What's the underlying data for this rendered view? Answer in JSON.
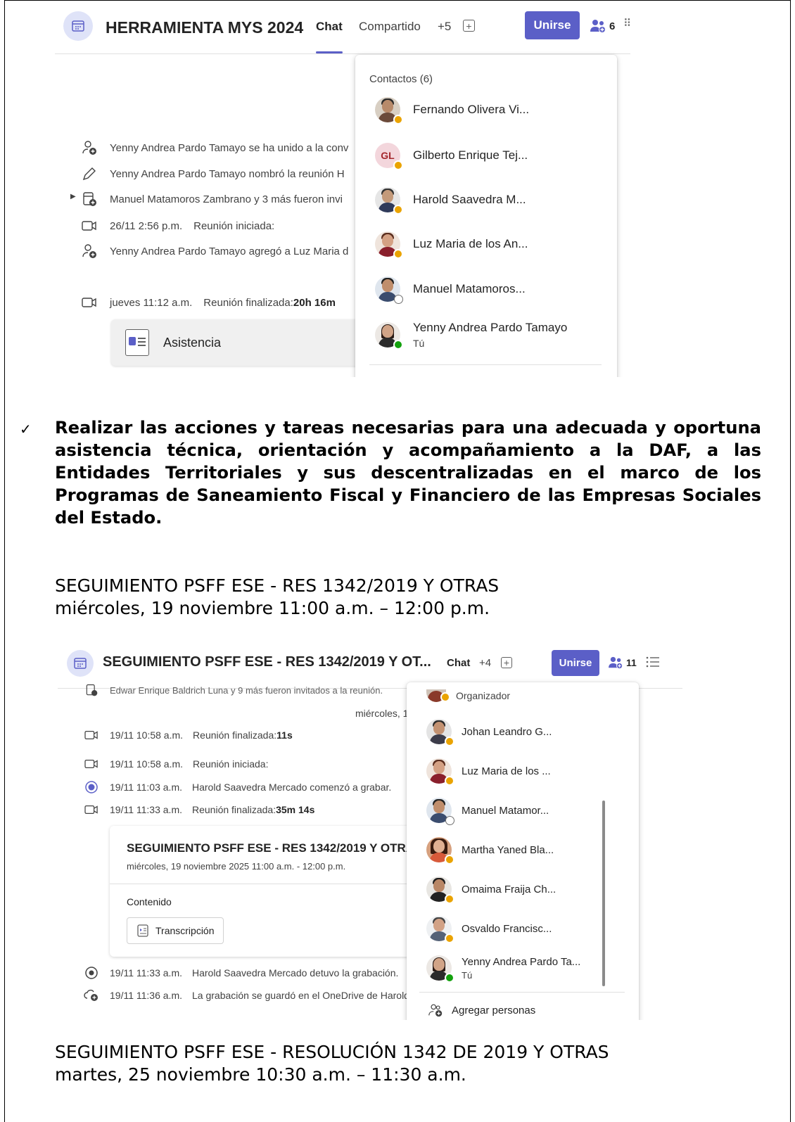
{
  "shot1": {
    "title": "HERRAMIENTA MYS 2024",
    "tabs": {
      "chat": "Chat",
      "shared": "Compartido",
      "more": "+5"
    },
    "join_label": "Unirse",
    "people_count": "6",
    "events": [
      "Yenny Andrea Pardo Tamayo se ha unido a la conv",
      "Yenny Andrea Pardo Tamayo nombró la reunión H",
      "Manuel Matamoros Zambrano y 3 más fueron invi",
      {
        "time": "26/11 2:56 p.m.",
        "text": "Reunión iniciada:"
      },
      "Yenny Andrea Pardo Tamayo agregó a Luz Maria d",
      {
        "time": "jueves 11:12 a.m.",
        "text": "Reunión finalizada: ",
        "duration": "20h 16m"
      }
    ],
    "attendance_label": "Asistencia",
    "contacts_heading": "Contactos (6)",
    "contacts": [
      {
        "name": "Fernando Olivera Vi...",
        "status": "away"
      },
      {
        "name": "Gilberto Enrique Tej...",
        "initials": "GL",
        "status": "away"
      },
      {
        "name": "Harold Saavedra M...",
        "status": "away"
      },
      {
        "name": "Luz Maria de los An...",
        "status": "away"
      },
      {
        "name": "Manuel Matamoros...",
        "status": "offline"
      },
      {
        "name": "Yenny Andrea Pardo Tamayo",
        "sub": "Tú",
        "status": "available"
      }
    ]
  },
  "body": {
    "check_mark": "✓",
    "bold_paragraph": "Realizar las acciones y tareas necesarias para una adecuada y oportuna asistencia técnica, orientación y acompañamiento a la DAF, a las Entidades Territoriales y sus descentralizadas en el marco de los Programas de Saneamiento Fiscal y Financiero de las Empresas Sociales del Estado.",
    "meeting1_title": "SEGUIMIENTO PSFF ESE - RES 1342/2019 Y OTRAS",
    "meeting1_time": "miércoles, 19 noviembre 11:00 a.m. – 12:00 p.m.",
    "meeting2_title": "SEGUIMIENTO PSFF ESE - RESOLUCIÓN 1342 DE 2019 Y OTRAS",
    "meeting2_time": "martes, 25 noviembre 10:30 a.m. – 11:30 a.m."
  },
  "shot2": {
    "title": "SEGUIMIENTO PSFF ESE - RES 1342/2019 Y OT...",
    "tabs": {
      "chat": "Chat",
      "more": "+4"
    },
    "join_label": "Unirse",
    "people_count": "11",
    "cut_event": "Edwar Enrique Baldrich Luna y 9 más fueron invitados a la reunión.",
    "date_fragment": "miércoles, 1",
    "events": [
      {
        "time": "19/11 10:58 a.m.",
        "text": "Reunión finalizada: ",
        "duration": "11s"
      },
      {
        "time": "19/11 10:58 a.m.",
        "text": "Reunión iniciada:"
      },
      {
        "time": "19/11 11:03 a.m.",
        "text": "Harold Saavedra Mercado comenzó a grabar."
      },
      {
        "time": "19/11 11:33 a.m.",
        "text": "Reunión finalizada: ",
        "duration": "35m 14s"
      }
    ],
    "card": {
      "title": "SEGUIMIENTO PSFF ESE - RES 1342/2019 Y OTRA",
      "subtitle": "miércoles, 19 noviembre 2025 11:00 a.m. - 12:00 p.m.",
      "content_label": "Contenido",
      "transcript_label": "Transcripción"
    },
    "events_after": [
      {
        "time": "19/11 11:33 a.m.",
        "text": "Harold Saavedra Mercado detuvo la grabación."
      },
      {
        "time": "19/11 11:36 a.m.",
        "text": "La grabación se guardó en el OneDrive de Harold"
      }
    ],
    "organizer_label": "Organizador",
    "contacts": [
      {
        "name": "Johan Leandro G...",
        "status": "away"
      },
      {
        "name": "Luz Maria de los ...",
        "status": "away"
      },
      {
        "name": "Manuel Matamor...",
        "status": "offline"
      },
      {
        "name": "Martha Yaned Bla...",
        "status": "away"
      },
      {
        "name": "Omaima Fraija Ch...",
        "status": "away"
      },
      {
        "name": "Osvaldo Francisc...",
        "status": "away"
      },
      {
        "name": "Yenny Andrea Pardo Ta...",
        "sub": "Tú",
        "status": "available"
      }
    ],
    "add_people_label": "Agregar personas"
  }
}
